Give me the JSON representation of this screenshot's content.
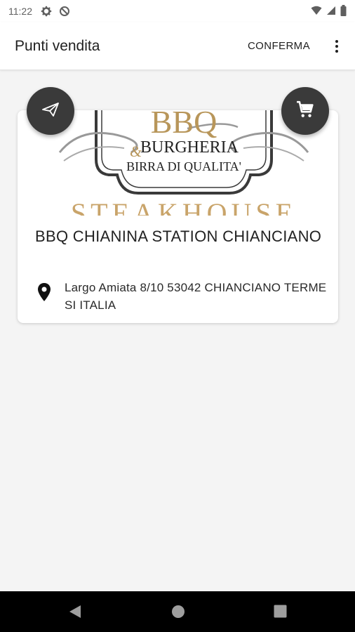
{
  "status_bar": {
    "time": "11:22",
    "icons": [
      "settings-icon",
      "data-saver-icon",
      "wifi-icon",
      "signal-icon",
      "battery-icon"
    ]
  },
  "app_bar": {
    "title": "Punti vendita",
    "confirm_label": "CONFERMA",
    "overflow_icon": "more-vert-icon"
  },
  "store_card": {
    "logo": {
      "line1": "BBQ",
      "line2": "BURGHERIA",
      "ampersand": "&",
      "line3": "BIRRA DI QUALITA'",
      "line4": "STEAKHOUSE"
    },
    "name": "BBQ CHIANINA STATION CHIANCIANO",
    "address": "Largo Amiata 8/10 53042 CHIANCIANO TERME SI ITALIA",
    "icons": {
      "send": "send-icon",
      "cart": "cart-icon",
      "pin": "location-pin-icon"
    }
  },
  "colors": {
    "fab": "#3a3a3a",
    "logo_gold": "#b8965a",
    "background": "#f4f4f4"
  }
}
